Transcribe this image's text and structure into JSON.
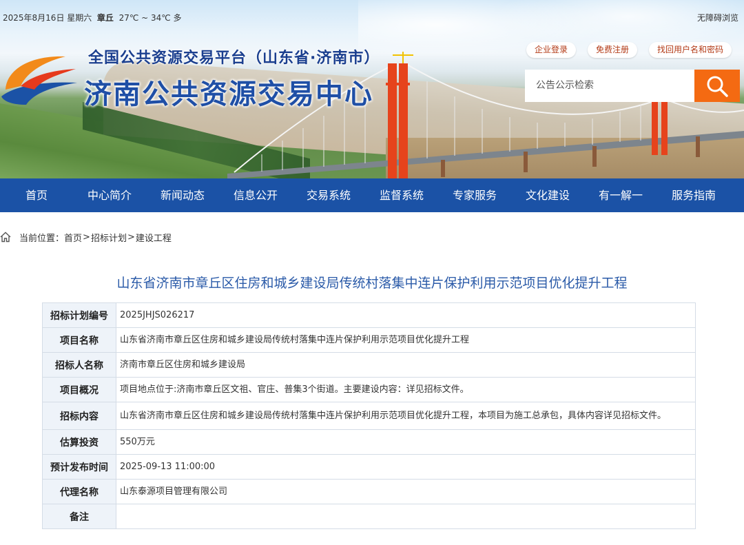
{
  "topbar": {
    "date": "2025年8月16日 星期六",
    "location": "章丘",
    "weather": "27℃ ~ 34℃ 多",
    "accessibility": "无障碍浏览"
  },
  "header": {
    "title_main": "全国公共资源交易平台（山东省·济南市）",
    "title_sub": "济南公共资源交易中心",
    "login_label": "企业登录",
    "register_label": "免费注册",
    "recover_label": "找回用户名和密码",
    "search_placeholder": "公告公示检索",
    "search_icon": "search-icon"
  },
  "nav": {
    "items": [
      {
        "label": "首页"
      },
      {
        "label": "中心简介"
      },
      {
        "label": "新闻动态"
      },
      {
        "label": "信息公开"
      },
      {
        "label": "交易系统"
      },
      {
        "label": "监督系统"
      },
      {
        "label": "专家服务"
      },
      {
        "label": "文化建设"
      },
      {
        "label": "有一解一"
      },
      {
        "label": "服务指南"
      }
    ]
  },
  "breadcrumb": {
    "prefix": "当前位置：",
    "items": [
      "首页",
      "招标计划",
      "建设工程"
    ],
    "separator": ">"
  },
  "page": {
    "title": "山东省济南市章丘区住房和城乡建设局传统村落集中连片保护利用示范项目优化提升工程"
  },
  "table": {
    "rows": [
      {
        "label": "招标计划编号",
        "value": "2025JHJS026217"
      },
      {
        "label": "项目名称",
        "value": "山东省济南市章丘区住房和城乡建设局传统村落集中连片保护利用示范项目优化提升工程"
      },
      {
        "label": "招标人名称",
        "value": "济南市章丘区住房和城乡建设局"
      },
      {
        "label": "项目概况",
        "value": "项目地点位于:济南市章丘区文祖、官庄、普集3个街道。主要建设内容：详见招标文件。"
      },
      {
        "label": "招标内容",
        "value": "山东省济南市章丘区住房和城乡建设局传统村落集中连片保护利用示范项目优化提升工程，本项目为施工总承包，具体内容详见招标文件。"
      },
      {
        "label": "估算投资",
        "value": "550万元"
      },
      {
        "label": "预计发布时间",
        "value": "2025-09-13 11:00:00"
      },
      {
        "label": "代理名称",
        "value": "山东泰源项目管理有限公司"
      },
      {
        "label": "备注",
        "value": ""
      }
    ]
  },
  "colors": {
    "nav_bg": "#1b52a6",
    "search_button": "#f46a12",
    "title_blue": "#2a5aa8",
    "label_bg": "#eef3f9"
  }
}
